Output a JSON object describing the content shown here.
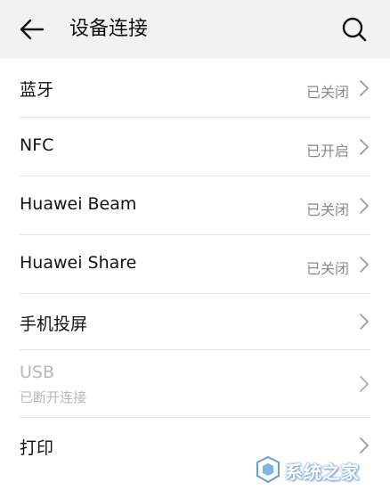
{
  "header": {
    "title": "设备连接"
  },
  "rows": [
    {
      "label": "蓝牙",
      "status": "已关闭"
    },
    {
      "label": "NFC",
      "status": "已开启"
    },
    {
      "label": "Huawei Beam",
      "status": "已关闭"
    },
    {
      "label": "Huawei Share",
      "status": "已关闭"
    },
    {
      "label": "手机投屏",
      "status": ""
    },
    {
      "label": "USB",
      "sublabel": "已断开连接",
      "status": ""
    },
    {
      "label": "打印",
      "status": ""
    }
  ],
  "watermark": {
    "text": "系统之家"
  },
  "icons": {
    "back": "back-arrow-icon",
    "search": "search-icon",
    "chevron": "chevron-right-icon"
  },
  "colors": {
    "header_bg": "#f2f2f2",
    "text_primary": "#111111",
    "text_secondary": "#8a8a8a",
    "text_disabled": "#b8b8b8"
  }
}
